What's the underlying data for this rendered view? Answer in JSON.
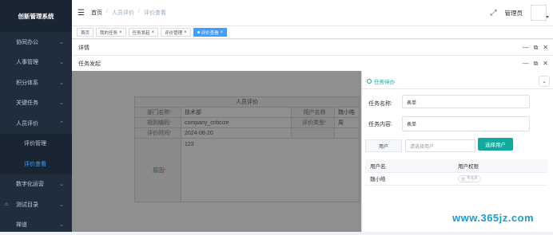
{
  "app_title": "创新管理系统",
  "sidebar": {
    "items": [
      {
        "label": "协同办公"
      },
      {
        "label": "人事管理"
      },
      {
        "label": "积分体系"
      },
      {
        "label": "关键任务"
      },
      {
        "label": "人员评价"
      },
      {
        "label": "评价管理"
      },
      {
        "label": "评价查看"
      },
      {
        "label": "数字化运营"
      },
      {
        "label": "测试目录"
      },
      {
        "label": "禅道"
      }
    ]
  },
  "header": {
    "breadcrumb": [
      "首页",
      "人员评价",
      "评价查看"
    ],
    "user_name": "管理员"
  },
  "tags": [
    {
      "label": "首页"
    },
    {
      "label": "我的任务"
    },
    {
      "label": "任务发起"
    },
    {
      "label": "评价管理"
    },
    {
      "label": "评价查看"
    }
  ],
  "panels": {
    "detail_title": "详情",
    "task_title": "任务发起"
  },
  "form": {
    "section_title": "人员评价",
    "dept_label": "部门名称",
    "dept_value": "技术部",
    "user_label": "用户名称",
    "user_value": "魏小皓",
    "rule_label": "规则编码",
    "rule_value": "company_criticize",
    "type_label": "评价类型",
    "type_value": "周",
    "time_label": "评价时间",
    "time_value": "2024-08-20",
    "reason_label": "原因",
    "reason_value": "123"
  },
  "drawer": {
    "tab_label": "任务待办",
    "name_label": "任务名称:",
    "name_value": "表单",
    "content_label": "任务内容:",
    "content_value": "表单",
    "user_label": "用户",
    "user_placeholder": "请选择用户",
    "select_button": "选择用户",
    "table_headers": [
      "用户名",
      "用户权限"
    ],
    "rows": [
      {
        "name": "魏小皓",
        "perm": "不允许"
      }
    ]
  },
  "watermark": "www.365jz.com",
  "colors": {
    "sidebar": "#1f2d3d",
    "accent": "#409eff",
    "teal": "#13a89e"
  }
}
